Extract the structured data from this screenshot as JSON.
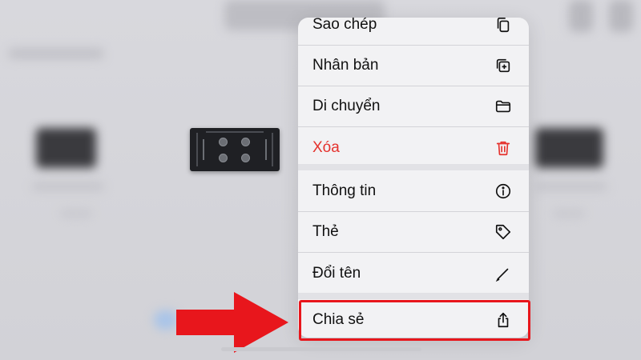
{
  "menu": {
    "items": [
      {
        "label": "Sao chép",
        "icon": "copy-icon"
      },
      {
        "label": "Nhân bản",
        "icon": "duplicate-icon"
      },
      {
        "label": "Di chuyển",
        "icon": "folder-icon"
      },
      {
        "label": "Xóa",
        "icon": "trash-icon",
        "destructive": true
      },
      {
        "label": "Thông tin",
        "icon": "info-icon"
      },
      {
        "label": "Thẻ",
        "icon": "tag-icon"
      },
      {
        "label": "Đổi tên",
        "icon": "pencil-icon"
      },
      {
        "label": "Chia sẻ",
        "icon": "share-icon",
        "highlighted": true
      }
    ]
  },
  "colors": {
    "destructive": "#e5322d",
    "highlight": "#e8161c",
    "arrow": "#e8161c",
    "menu_bg": "#f2f2f4"
  }
}
